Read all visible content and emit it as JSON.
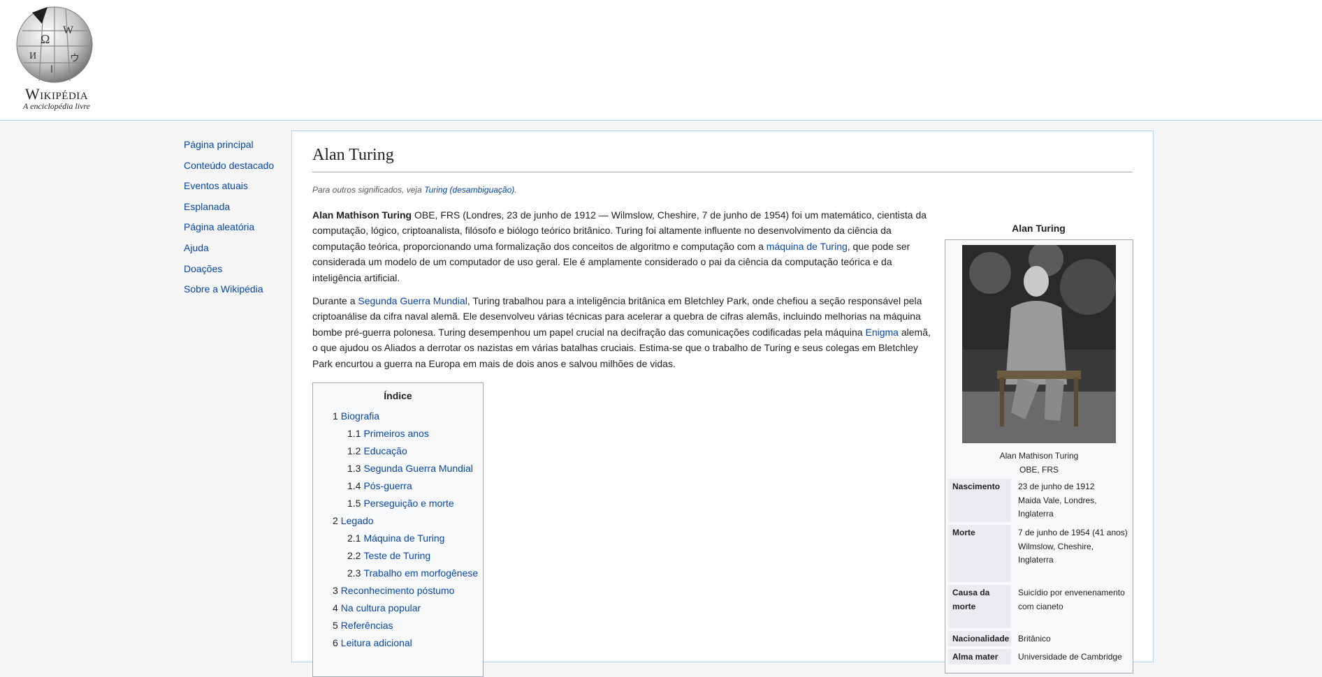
{
  "logo": {
    "wordmark": "Wikipédia",
    "tagline": "A enciclopédia livre"
  },
  "sidebar": {
    "items": [
      {
        "label": "Página principal"
      },
      {
        "label": "Conteúdo destacado"
      },
      {
        "label": "Eventos atuais"
      },
      {
        "label": "Esplanada"
      },
      {
        "label": "Página aleatória"
      },
      {
        "label": "Ajuda"
      },
      {
        "label": "Doações"
      },
      {
        "label": "Sobre a Wikipédia"
      }
    ]
  },
  "article": {
    "title": "Alan Turing",
    "hatnote": {
      "prefix": "Para outros significados, veja ",
      "link": "Turing (desambiguação)",
      "suffix": "."
    },
    "para1": {
      "bold": "Alan Mathison Turing",
      "text1": " OBE, FRS (Londres, 23 de junho de 1912 — Wilmslow, Cheshire, 7 de junho de 1954) foi um matemático, cientista da computação, lógico, criptoanalista, filósofo e biólogo teórico britânico. Turing foi altamente influente no desenvolvimento da ciência da computação teórica, proporcionando uma formalização dos conceitos de algoritmo e computação com a ",
      "link1": "máquina de Turing",
      "text2": ", que pode ser considerada um modelo de um computador de uso geral. Ele é amplamente considerado o pai da ciência da computação teórica e da inteligência artificial."
    },
    "para2": {
      "text1": "Durante a ",
      "link1": "Segunda Guerra Mundial",
      "text2": ", Turing trabalhou para a inteligência britânica em Bletchley Park, onde chefiou a seção responsável pela criptoanálise da cifra naval alemã. Ele desenvolveu várias técnicas para acelerar a quebra de cifras alemãs, incluindo melhorias na máquina bombe pré-guerra polonesa. Turing desempenhou um papel crucial na decifração das comunicações codificadas pela máquina ",
      "link2": "Enigma",
      "text3": " alemã, o que ajudou os Aliados a derrotar os nazistas em várias batalhas cruciais. Estima-se que o trabalho de Turing e seus colegas em Bletchley Park encurtou a guerra na Europa em mais de dois anos e salvou milhões de vidas."
    }
  },
  "toc": {
    "title": "Índice",
    "items": [
      {
        "num": "1",
        "label": "Biografia",
        "level": 1
      },
      {
        "num": "1.1",
        "label": "Primeiros anos",
        "level": 2
      },
      {
        "num": "1.2",
        "label": "Educação",
        "level": 2
      },
      {
        "num": "1.3",
        "label": "Segunda Guerra Mundial",
        "level": 2
      },
      {
        "num": "1.4",
        "label": "Pós-guerra",
        "level": 2
      },
      {
        "num": "1.5",
        "label": "Perseguição e morte",
        "level": 2
      },
      {
        "num": "2",
        "label": "Legado",
        "level": 1
      },
      {
        "num": "2.1",
        "label": "Máquina de Turing",
        "level": 2
      },
      {
        "num": "2.2",
        "label": "Teste de Turing",
        "level": 2
      },
      {
        "num": "2.3",
        "label": "Trabalho em morfogênese",
        "level": 2
      },
      {
        "num": "3",
        "label": "Reconhecimento póstumo",
        "level": 1
      },
      {
        "num": "4",
        "label": "Na cultura popular",
        "level": 1
      },
      {
        "num": "5",
        "label": "Referências",
        "level": 1
      },
      {
        "num": "6",
        "label": "Leitura adicional",
        "level": 1
      }
    ]
  },
  "infobox": {
    "title": "Alan Turing",
    "caption_line1": "Alan Mathison Turing",
    "caption_line2": "OBE, FRS",
    "rows": [
      {
        "label": "Nascimento",
        "value": "23 de junho de 1912\nMaida Vale, Londres, Inglaterra"
      },
      {
        "label": "Morte",
        "value": "7 de junho de 1954 (41 anos)\nWilmslow, Cheshire, Inglaterra"
      },
      {
        "label": "Causa da morte",
        "value": "Suicídio por envenenamento com cianeto"
      },
      {
        "label": "Nacionalidade",
        "value": "Britânico"
      },
      {
        "label": "Alma mater",
        "value": "Universidade de Cambridge"
      }
    ]
  }
}
